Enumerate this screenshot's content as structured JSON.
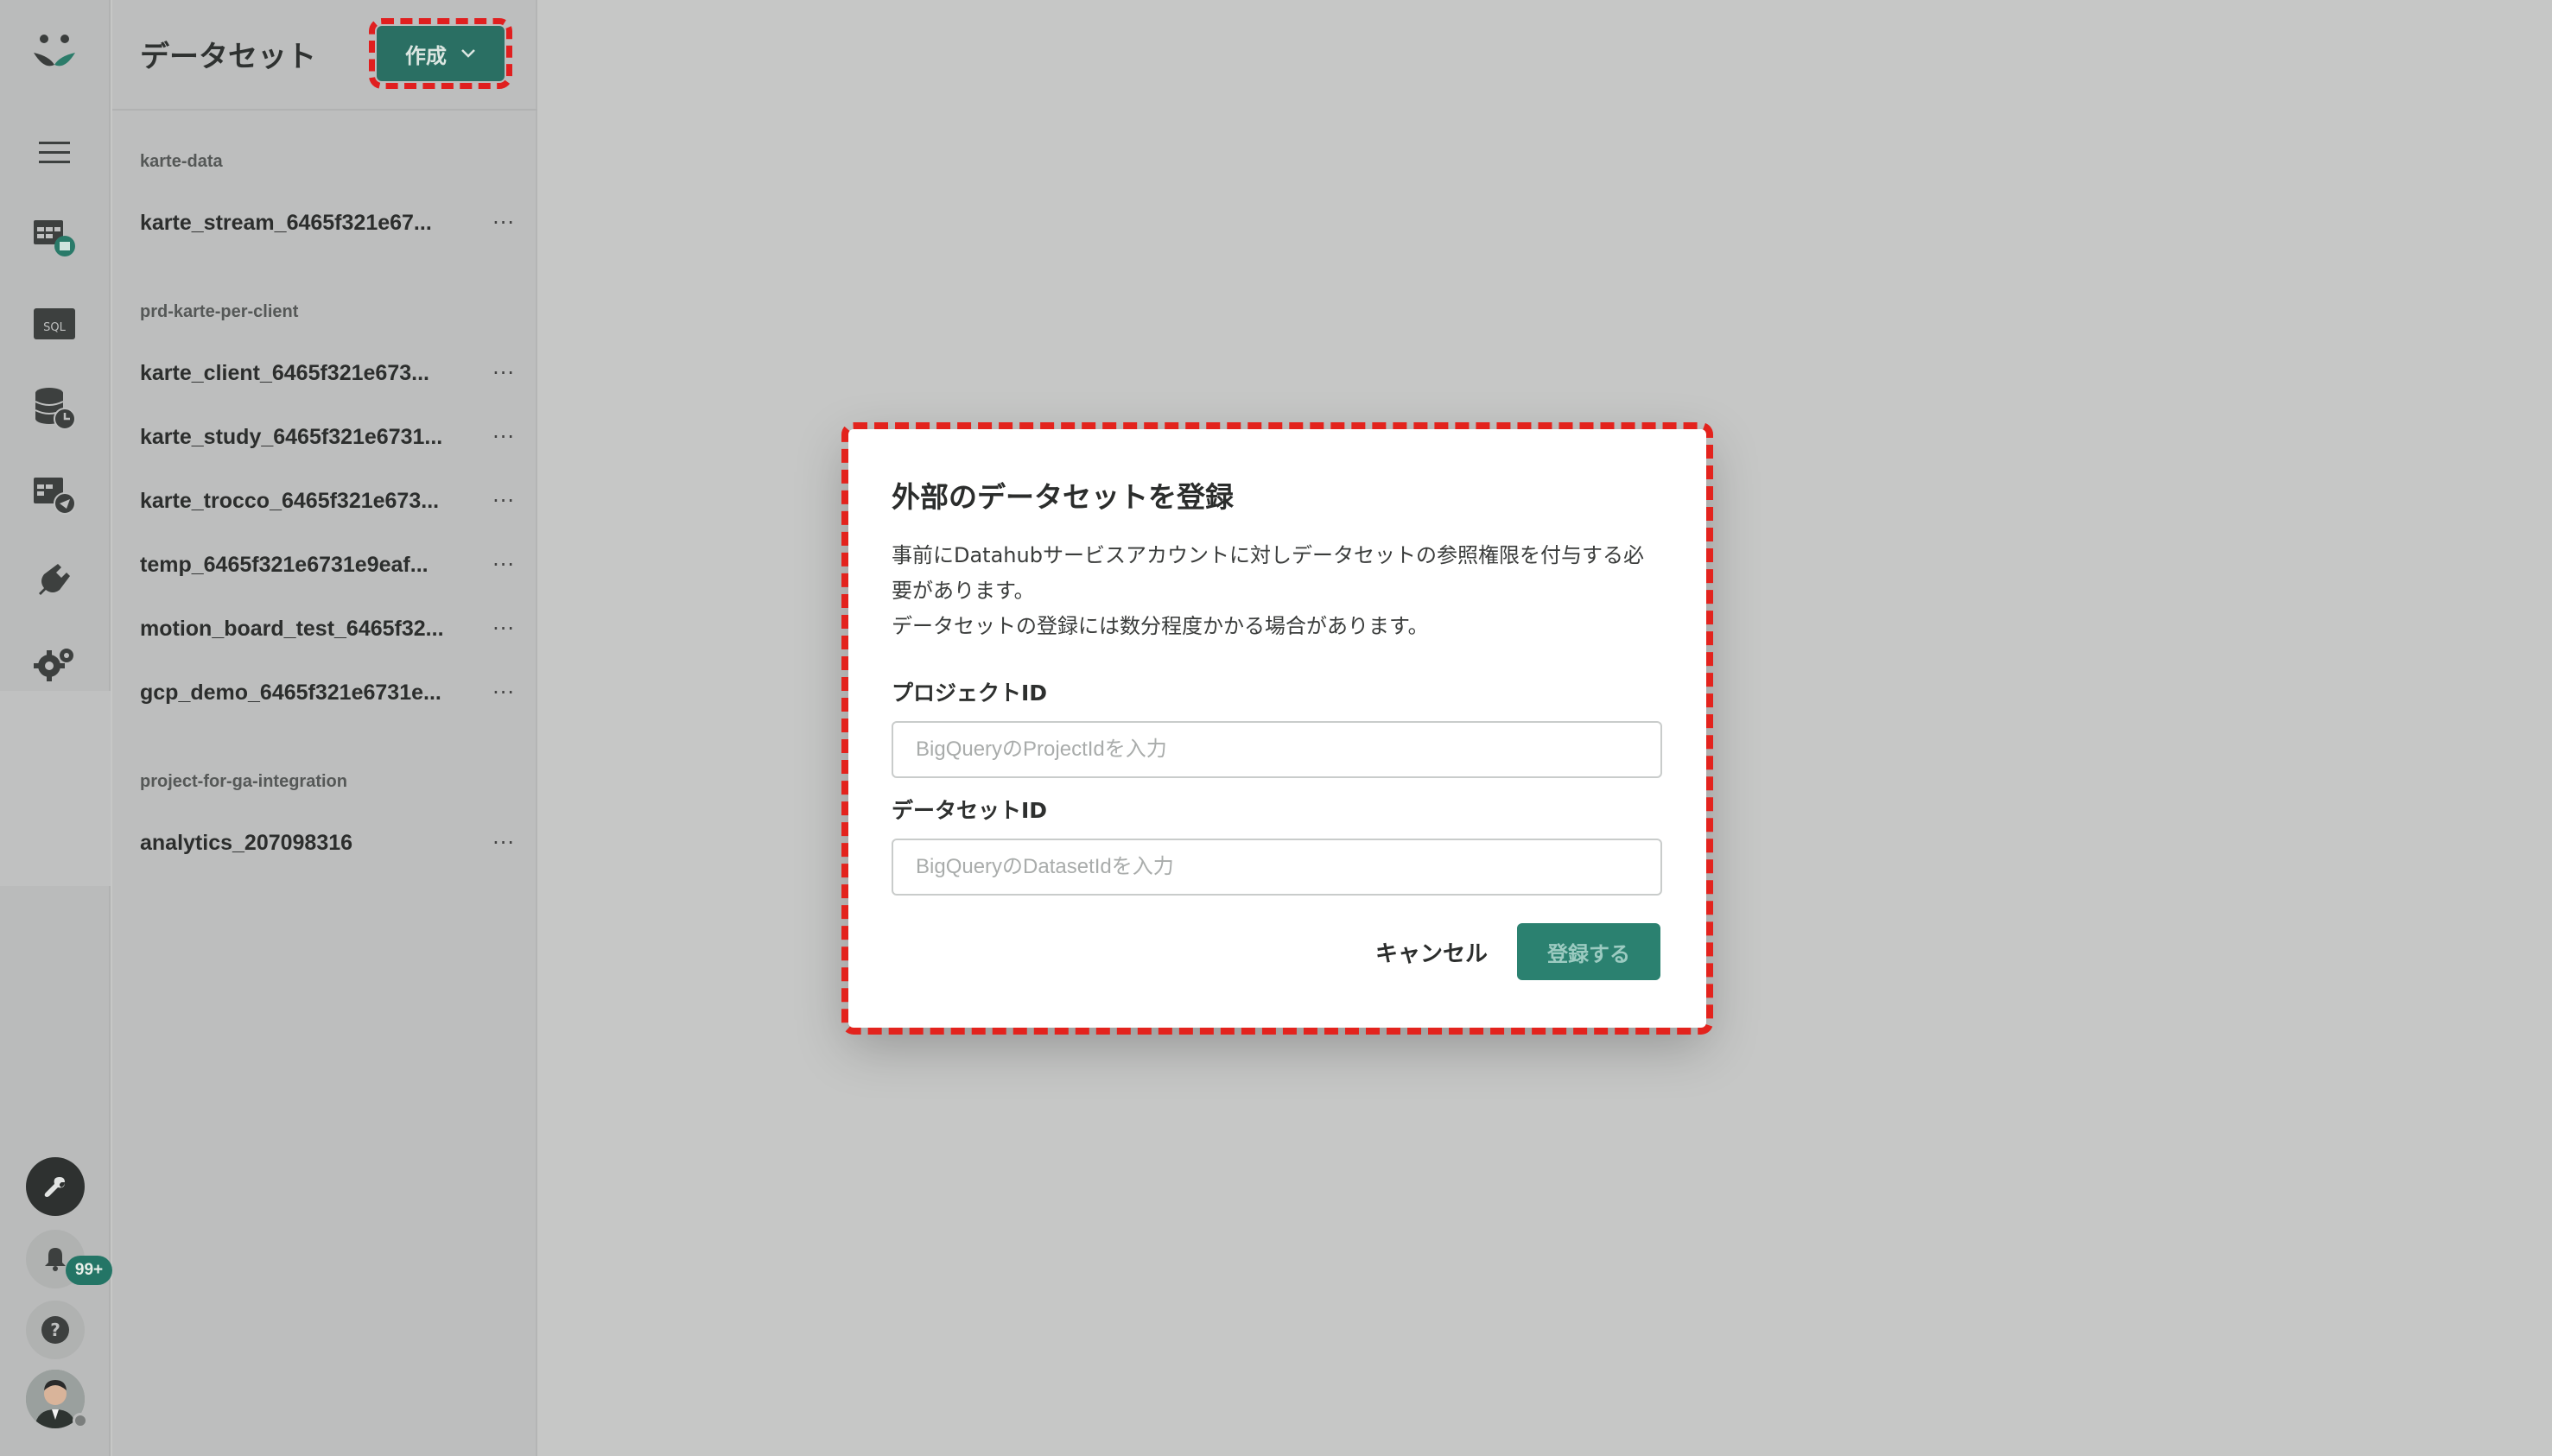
{
  "sidebar": {
    "notifications_badge": "99+"
  },
  "panel": {
    "title": "データセット",
    "create_button": "作成",
    "groups": [
      {
        "label": "karte-data",
        "items": [
          "karte_stream_6465f321e67..."
        ]
      },
      {
        "label": "prd-karte-per-client",
        "items": [
          "karte_client_6465f321e673...",
          "karte_study_6465f321e6731...",
          "karte_trocco_6465f321e673...",
          "temp_6465f321e6731e9eaf...",
          "motion_board_test_6465f32...",
          "gcp_demo_6465f321e6731e..."
        ]
      },
      {
        "label": "project-for-ga-integration",
        "items": [
          "analytics_207098316"
        ]
      }
    ],
    "more_label": "···"
  },
  "dialog": {
    "title": "外部のデータセットを登録",
    "description_line1": "事前にDatahubサービスアカウントに対しデータセットの参照権限を付与する必",
    "description_line2": "要があります。",
    "description_line3": "データセットの登録には数分程度かかる場合があります。",
    "project_label": "プロジェクトID",
    "project_placeholder": "BigQueryのProjectIdを入力",
    "dataset_label": "データセットID",
    "dataset_placeholder": "BigQueryのDatasetIdを入力",
    "cancel_label": "キャンセル",
    "register_label": "登録する"
  },
  "colors": {
    "accent": "#2b8170",
    "highlight": "#e3231d"
  }
}
